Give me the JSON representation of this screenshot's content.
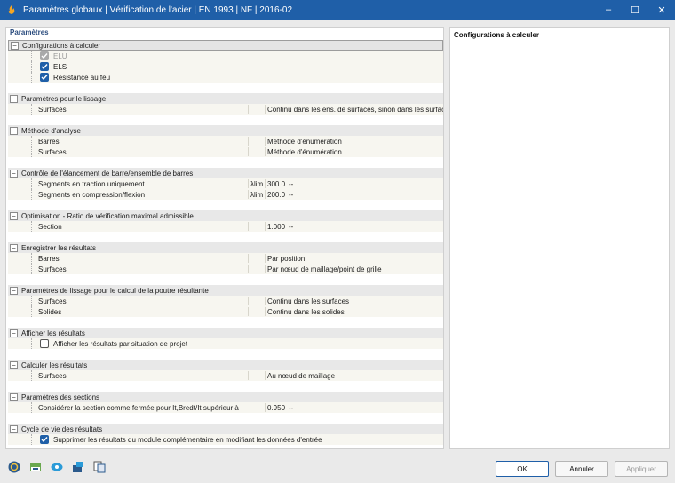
{
  "window": {
    "title": "Paramètres globaux | Vérification de l'acier | EN 1993 | NF | 2016-02",
    "minimize": "–",
    "maximize": "☐",
    "close": "✕"
  },
  "left_panel": {
    "header": "Paramètres"
  },
  "right_panel": {
    "title": "Configurations à calculer"
  },
  "groups": {
    "configs": {
      "label": "Configurations à calculer",
      "toggle": "−",
      "items": [
        {
          "label": "ELU",
          "checked": true,
          "disabled": true
        },
        {
          "label": "ELS",
          "checked": true,
          "disabled": false
        },
        {
          "label": "Résistance au feu",
          "checked": true,
          "disabled": false
        }
      ]
    },
    "lissage": {
      "label": "Paramètres pour le lissage",
      "toggle": "−",
      "items": [
        {
          "name": "Surfaces",
          "value": "Continu dans les ens. de surfaces, sinon dans les surfaces"
        }
      ]
    },
    "analyse": {
      "label": "Méthode d'analyse",
      "toggle": "−",
      "items": [
        {
          "name": "Barres",
          "value": "Méthode d'énumération"
        },
        {
          "name": "Surfaces",
          "value": "Méthode d'énumération"
        }
      ]
    },
    "elancement": {
      "label": "Contrôle de l'élancement de barre/ensemble de barres",
      "toggle": "−",
      "items": [
        {
          "name": "Segments en traction uniquement",
          "symbol": "λlim",
          "value": "300.0",
          "unit": "--"
        },
        {
          "name": "Segments en compression/flexion",
          "symbol": "λlim",
          "value": "200.0",
          "unit": "--"
        }
      ]
    },
    "optimisation": {
      "label": "Optimisation - Ratio de vérification maximal admissible",
      "toggle": "−",
      "items": [
        {
          "name": "Section",
          "value": "1.000",
          "unit": "--"
        }
      ]
    },
    "enregistrer": {
      "label": "Enregistrer les résultats",
      "toggle": "−",
      "items": [
        {
          "name": "Barres",
          "value": "Par position"
        },
        {
          "name": "Surfaces",
          "value": "Par nœud de maillage/point de grille"
        }
      ]
    },
    "poutre": {
      "label": "Paramètres de lissage pour le calcul de la poutre résultante",
      "toggle": "−",
      "items": [
        {
          "name": "Surfaces",
          "value": "Continu dans les surfaces"
        },
        {
          "name": "Solides",
          "value": "Continu dans les solides"
        }
      ]
    },
    "afficher": {
      "label": "Afficher les résultats",
      "toggle": "−",
      "items": [
        {
          "label": "Afficher les résultats par situation de projet",
          "checked": false
        }
      ]
    },
    "calculer": {
      "label": "Calculer les résultats",
      "toggle": "−",
      "items": [
        {
          "name": "Surfaces",
          "value": "Au nœud de maillage"
        }
      ]
    },
    "sections": {
      "label": "Paramètres des sections",
      "toggle": "−",
      "items": [
        {
          "name": "Considérer la section comme fermée pour It,Bredt/It supérieur à",
          "value": "0.950",
          "unit": "--"
        }
      ]
    },
    "cycle": {
      "label": "Cycle de vie des résultats",
      "toggle": "−",
      "items": [
        {
          "label": "Supprimer les résultats du module complémentaire en modifiant les données d'entrée",
          "checked": true
        }
      ]
    }
  },
  "footer": {
    "icons": [
      "help-icon",
      "units-icon",
      "view-icon",
      "export-icon",
      "copy-icon"
    ],
    "ok": "OK",
    "cancel": "Annuler",
    "apply": "Appliquer"
  },
  "colors": {
    "title_bar": "#1f5fa8",
    "accent": "#1f5fa8",
    "group_bg": "#e8e8e8",
    "item_bg": "#f7f6f0"
  }
}
